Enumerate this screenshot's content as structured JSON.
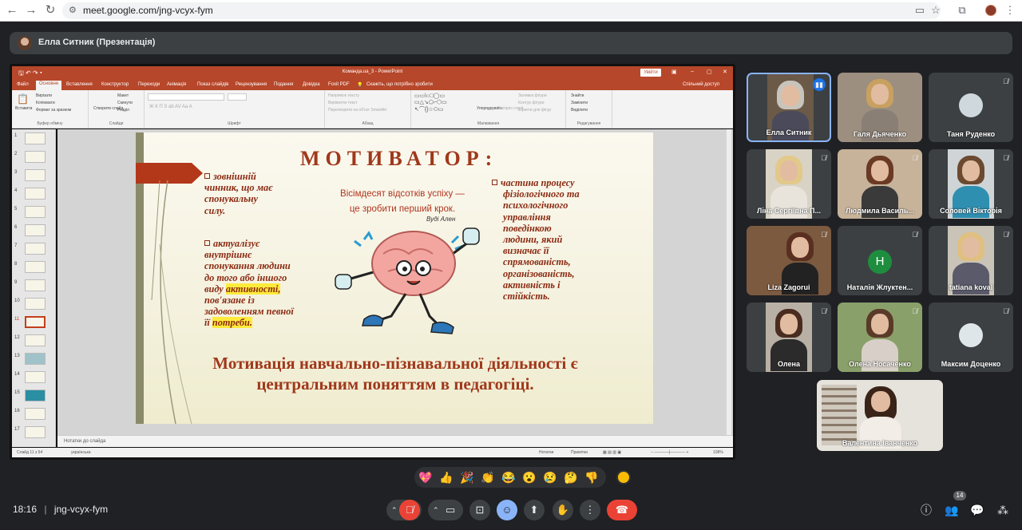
{
  "browser": {
    "url": "meet.google.com/jng-vcyx-fym",
    "back": "←",
    "forward": "→",
    "reload": "↻"
  },
  "presenter_bar": {
    "label": "Елла Ситник (Презентація)"
  },
  "ppt": {
    "title": "Команда.ua_3  -  PowerPoint",
    "signin": "Увійти",
    "tabs": [
      "Файл",
      "Основне",
      "Вставлення",
      "Конструктор",
      "Переходи",
      "Анімація",
      "Показ слайдів",
      "Рецензування",
      "Подання",
      "Довідка",
      "Foxit PDF"
    ],
    "tellme": "Скажіть, що потрібно зробити",
    "share": "Спільний доступ",
    "ribbon": {
      "paste": "Вставити",
      "cut": "Вирізати",
      "copy": "Копіювати",
      "format_painter": "Формат за зразком",
      "clipboard_group": "Буфер обміну",
      "new_slide": "Створити слайд",
      "layout": "Макет",
      "reset": "Скинути",
      "section": "Розділ",
      "slides_group": "Слайди",
      "font_group": "Шрифт",
      "text_dir": "Напрямок тексту",
      "align_text": "Вирівняти текст",
      "smartart": "Перетворити на об'єкт SmartArt",
      "paragraph_group": "Абзац",
      "arrange": "Упорядкувати",
      "quick_styles": "Експрес-стилі",
      "shape_fill": "Заливка фігури",
      "shape_outline": "Контур фігури",
      "shape_effects": "Ефекти для фігур",
      "drawing_group": "Малювання",
      "find": "Знайти",
      "replace": "Замінити",
      "select": "Виділити",
      "editing_group": "Редагування"
    },
    "slide_numbers": [
      "1",
      "2",
      "3",
      "4",
      "5",
      "6",
      "7",
      "8",
      "9",
      "10",
      "11",
      "12",
      "13",
      "14",
      "15",
      "16",
      "17"
    ],
    "selected_slide": "11",
    "slide": {
      "title": "МОТИВАТОР:",
      "quote_line1": "Вісімдесят відсотків успіху —",
      "quote_line2": "це зробити перший крок.",
      "quote_author": "Вуді Ален",
      "left1": [
        "зовнішній",
        "чинник, що має",
        "спонукальну",
        "силу."
      ],
      "left2_a": [
        "актуалізує",
        "внутрішнє",
        "спонукання людини",
        "до того або іншого"
      ],
      "left2_b_pre": "виду",
      "left2_b_hl": "активності,",
      "left2_c": [
        "пов'язане із",
        "задоволенням певної"
      ],
      "left2_d_pre": "її",
      "left2_d_hl": "потреби.",
      "right": [
        "частина процесу",
        "фізіологічного та",
        "психологічного",
        "управління",
        "поведінкою",
        "людини, який",
        "визначає її",
        "спрямованість,",
        "організованість,",
        "активність і",
        "стійкість."
      ],
      "bottom": "Мотивація навчально-пізнавальної діяльності є центральним поняттям в педагогіці."
    },
    "notes": "Нотатки до слайда",
    "status_slide": "Слайд 11 з 54",
    "status_lang": "українська",
    "status_notes": "Нотатки",
    "status_comments": "Примітки",
    "zoom": "108%"
  },
  "participants": [
    {
      "name": "Елла Ситник",
      "state": "speaking"
    },
    {
      "name": "Галя Дьяченко",
      "state": "video"
    },
    {
      "name": "Таня Руденко",
      "state": "avatar"
    },
    {
      "name": "Ліна Сергіївна П...",
      "state": "video"
    },
    {
      "name": "Людмила Василь...",
      "state": "video"
    },
    {
      "name": "Соловей Вікторія",
      "state": "video"
    },
    {
      "name": "Liza Zagorui",
      "state": "video"
    },
    {
      "name": "Наталія Жлуктен...",
      "state": "letter",
      "letter": "Н",
      "color": "#1e8e3e"
    },
    {
      "name": "tatiana koval",
      "state": "video"
    },
    {
      "name": "Олена",
      "state": "video"
    },
    {
      "name": "Олена Носаченко",
      "state": "video"
    },
    {
      "name": "Максим Доценко",
      "state": "avatar"
    },
    {
      "name": "Валентина Іванченко",
      "state": "video"
    }
  ],
  "reactions": [
    "💖",
    "👍",
    "🎉",
    "👏",
    "😂",
    "😮",
    "😢",
    "🤔",
    "👎"
  ],
  "bottom": {
    "time": "18:16",
    "separator": "|",
    "meeting_code": "jng-vcyx-fym",
    "participant_count": "14"
  },
  "colors": {
    "ppt_accent": "#b7472a",
    "slide_text": "#8b2a12",
    "highlight": "#ffeb3b",
    "end_call": "#ea4335",
    "active_blue": "#8ab4f8"
  }
}
